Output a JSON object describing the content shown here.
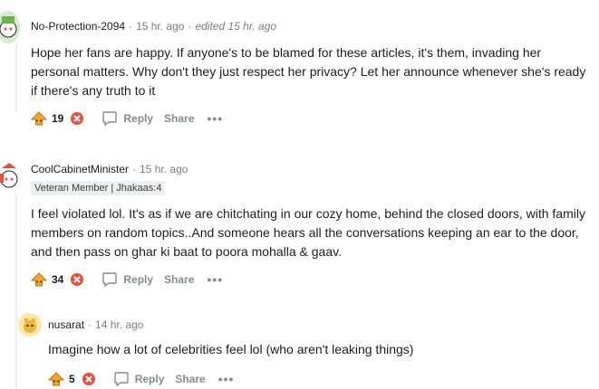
{
  "comments": [
    {
      "author": "No-Protection-2094",
      "time": "15 hr. ago",
      "edited": "edited 15 hr. ago",
      "body": "Hope her fans are happy. If anyone's to be blamed for these articles, it's them, invading her personal matters. Why don't they just respect her privacy? Let her announce whenever she's ready if there's any truth to it",
      "score": "19",
      "reply_label": "Reply",
      "share_label": "Share",
      "more_label": "•••"
    },
    {
      "author": "CoolCabinetMinister",
      "time": "15 hr. ago",
      "flair": "Veteran Member | Jhakaas:4",
      "body": "I feel violated lol. It's as if we are chitchating in our cozy home, behind the closed doors, with family members on random topics..And someone hears all the conversations keeping an ear to the door, and then pass on ghar ki baat to poora mohalla & gaav.",
      "score": "34",
      "reply_label": "Reply",
      "share_label": "Share",
      "more_label": "•••"
    },
    {
      "author": "nusarat",
      "time": "14 hr. ago",
      "body": "Imagine how a lot of celebrities feel lol (who aren't leaking things)",
      "score": "5",
      "reply_label": "Reply",
      "share_label": "Share",
      "more_label": "•••"
    }
  ],
  "colors": {
    "upvote": "#f5a623",
    "downvote": "#e8503a",
    "thread_line": "#edeff1"
  }
}
